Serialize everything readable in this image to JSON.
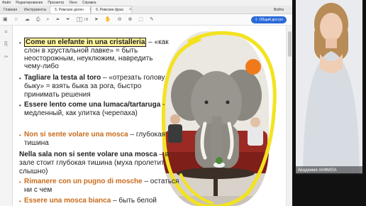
{
  "menu": [
    "Файл",
    "Редактирование",
    "Просмотр",
    "Окно",
    "Справка"
  ],
  "tabs": {
    "home": "Главная",
    "tools": "Инструменты",
    "doc1": "5. Римские делен",
    "doc2": "6. Римские фраз",
    "close": "×",
    "signin": "Войти"
  },
  "toolbar": {
    "page_current": "1",
    "page_total": "/ 8",
    "share_label": "Общий доступ"
  },
  "content": {
    "item1_phrase": "Come un elefante in una cristalleria",
    "item1_line1_rest": " – «как",
    "item1_line2": "слон в хрустальной лавке» = быть",
    "item1_line3": "неосторожным, неуклюжим, навредить",
    "item1_line4": "чему-либо",
    "item2_phrase": "Tagliare la testa al toro",
    "item2_line1_rest": " – «отрезать голову",
    "item2_line2": "быку» = взять быка за рога, быстро",
    "item2_line3": "принимать решения",
    "item3_phrase": "Essere lento come una lumaca/tartaruga",
    "item3_line1_rest": " -",
    "item3_line2": "медленный, как улитка (черепаха)",
    "item4_phrase": "Non si sente volare una mosca",
    "item4_rest": " – глубокая",
    "item4_line2": "тишина",
    "item5_phrase": "Nella sala non si sente volare una mosca",
    "item5_rest": " – в",
    "item5_line2": "зале стоит глубокая тишина (муха пролетит",
    "item5_line3": "слышно)",
    "item6_phrase": "Rimanere con un pugno di mosche",
    "item6_rest": " – остаться",
    "item6_line2": "ни с чем",
    "item7_phrase": "Essere una mosca bianca",
    "item7_rest": " – быть белой"
  },
  "video": {
    "participant_name": "Академия АНФИЛА"
  },
  "colors": {
    "highlight": "#fff59a",
    "accent_orange": "#c76b1a",
    "share_blue": "#2a6ad8",
    "scribble_yellow": "#f3e31f",
    "annotation_dot": "#f07a1a"
  }
}
